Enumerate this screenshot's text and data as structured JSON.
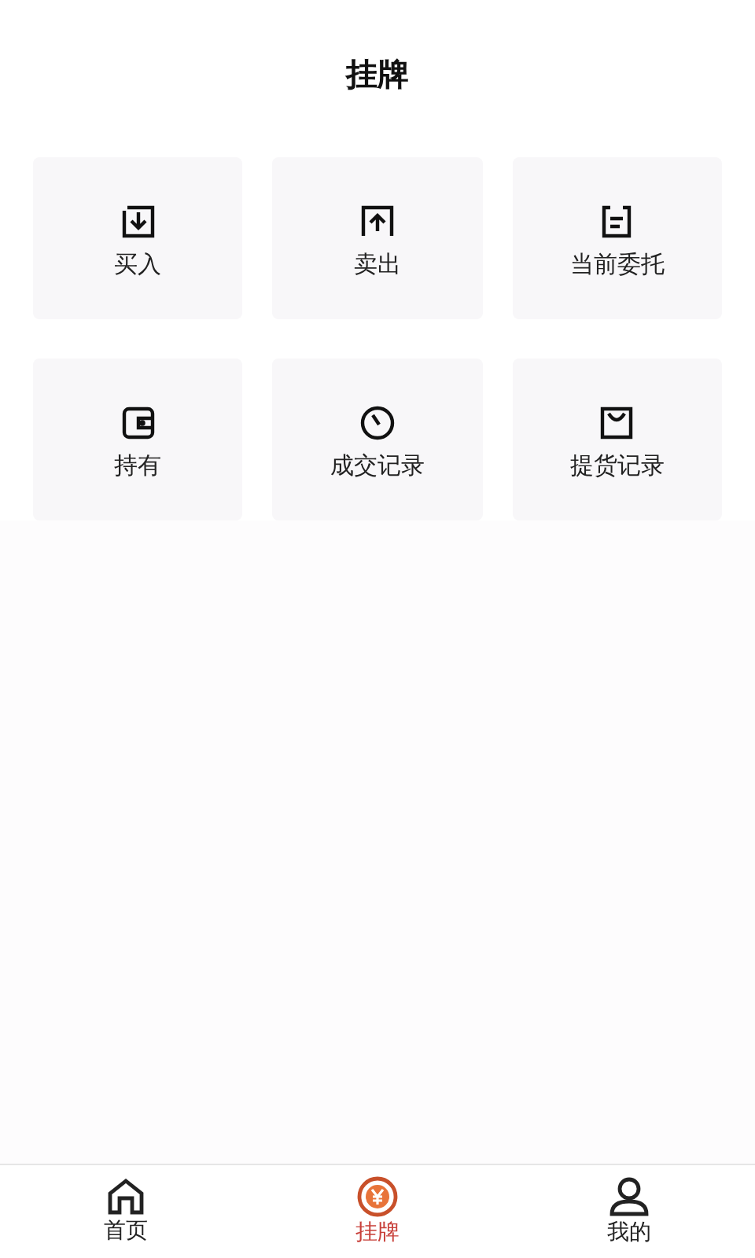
{
  "header": {
    "title": "挂牌"
  },
  "menu": [
    {
      "label": "买入",
      "kind": "download"
    },
    {
      "label": "卖出",
      "kind": "upload"
    },
    {
      "label": "当前委托",
      "kind": "note"
    },
    {
      "label": "持有",
      "kind": "wallet"
    },
    {
      "label": "成交记录",
      "kind": "clock"
    },
    {
      "label": "提货记录",
      "kind": "bag"
    }
  ],
  "tabbar": [
    {
      "label": "首页",
      "kind": "home",
      "selected": false
    },
    {
      "label": "挂牌",
      "kind": "yen",
      "selected": true
    },
    {
      "label": "我的",
      "kind": "user",
      "selected": false
    }
  ]
}
